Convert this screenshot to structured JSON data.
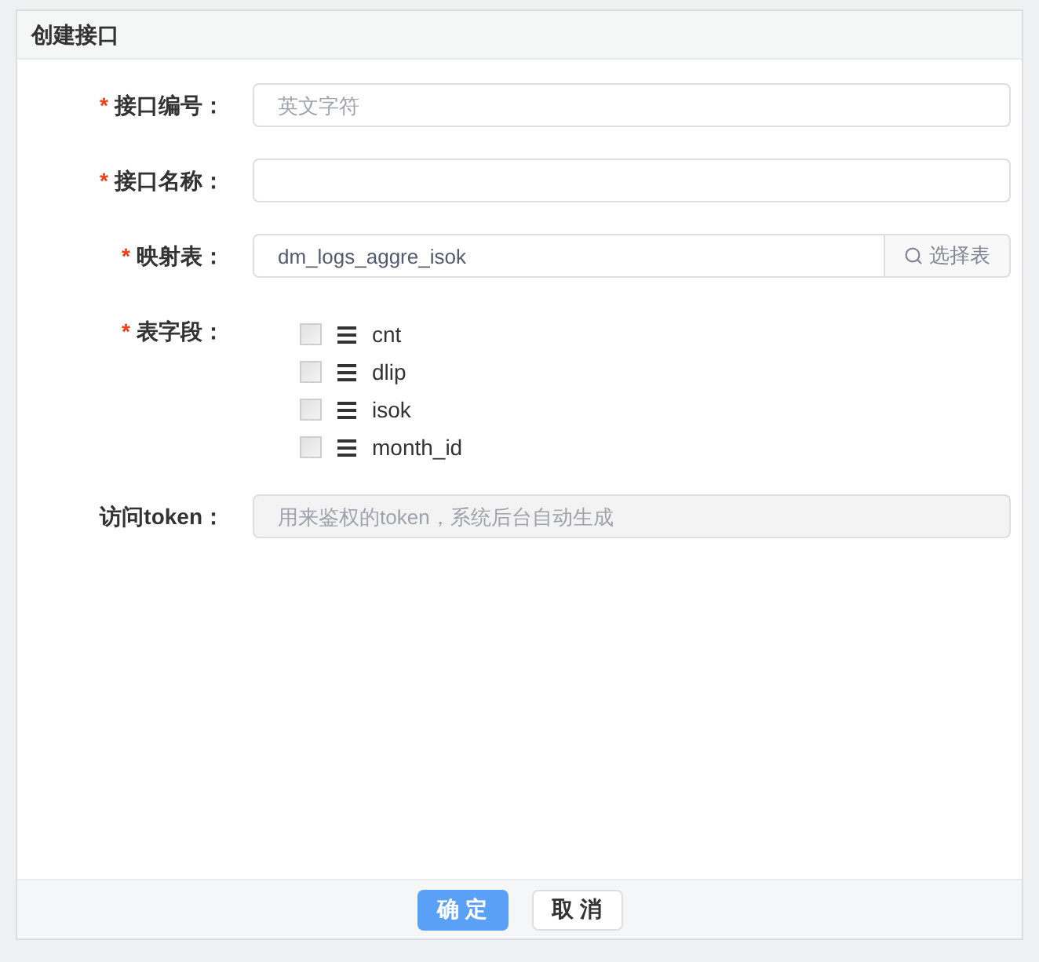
{
  "dialog": {
    "title": "创建接口"
  },
  "fields": [
    {
      "kind": "input",
      "label": "接口编号：",
      "marker": "*",
      "placeholder": "英文字符",
      "disabled": false
    },
    {
      "kind": "input",
      "label": "接口名称：",
      "marker": "*",
      "disabled": false
    },
    {
      "kind": "picker",
      "label": "映射表：",
      "marker": "*",
      "value": "dm_logs_aggre_isok",
      "button": "选择表"
    },
    {
      "kind": "columns",
      "label": "表字段：",
      "marker": "*",
      "items": [
        {
          "name": "cnt",
          "checked": false,
          "disabled": true
        },
        {
          "name": "dlip",
          "checked": false,
          "disabled": true
        },
        {
          "name": "isok",
          "checked": false,
          "disabled": true
        },
        {
          "name": "month_id",
          "checked": false,
          "disabled": true
        }
      ]
    },
    {
      "kind": "input",
      "label": "访问token：",
      "placeholder": "用来鉴权的token，系统后台自动生成",
      "disabled": true
    }
  ],
  "buttons": [
    {
      "label": "确 定",
      "primary": true
    },
    {
      "label": "取 消",
      "primary": false
    }
  ]
}
